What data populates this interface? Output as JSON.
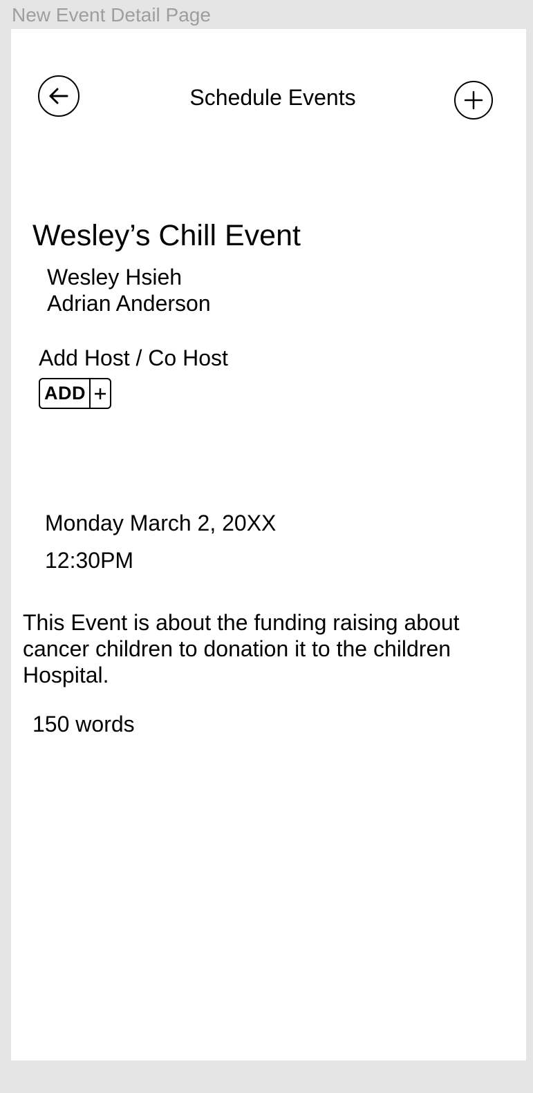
{
  "frame": {
    "label": "New Event Detail Page"
  },
  "header": {
    "title": "Schedule Events",
    "back_icon": "arrow-left-circle-icon",
    "add_icon": "plus-circle-icon"
  },
  "event": {
    "title": "Wesley’s Chill Event",
    "hosts": [
      "Wesley Hsieh",
      "Adrian Anderson"
    ],
    "add_host_label": "Add Host / Co Host",
    "add_host_button_label": "ADD",
    "date": "Monday March 2, 20XX",
    "time": "12:30PM",
    "description": "This Event is about the funding raising about cancer children to donation it to the children Hospital.",
    "word_count": "150 words"
  }
}
